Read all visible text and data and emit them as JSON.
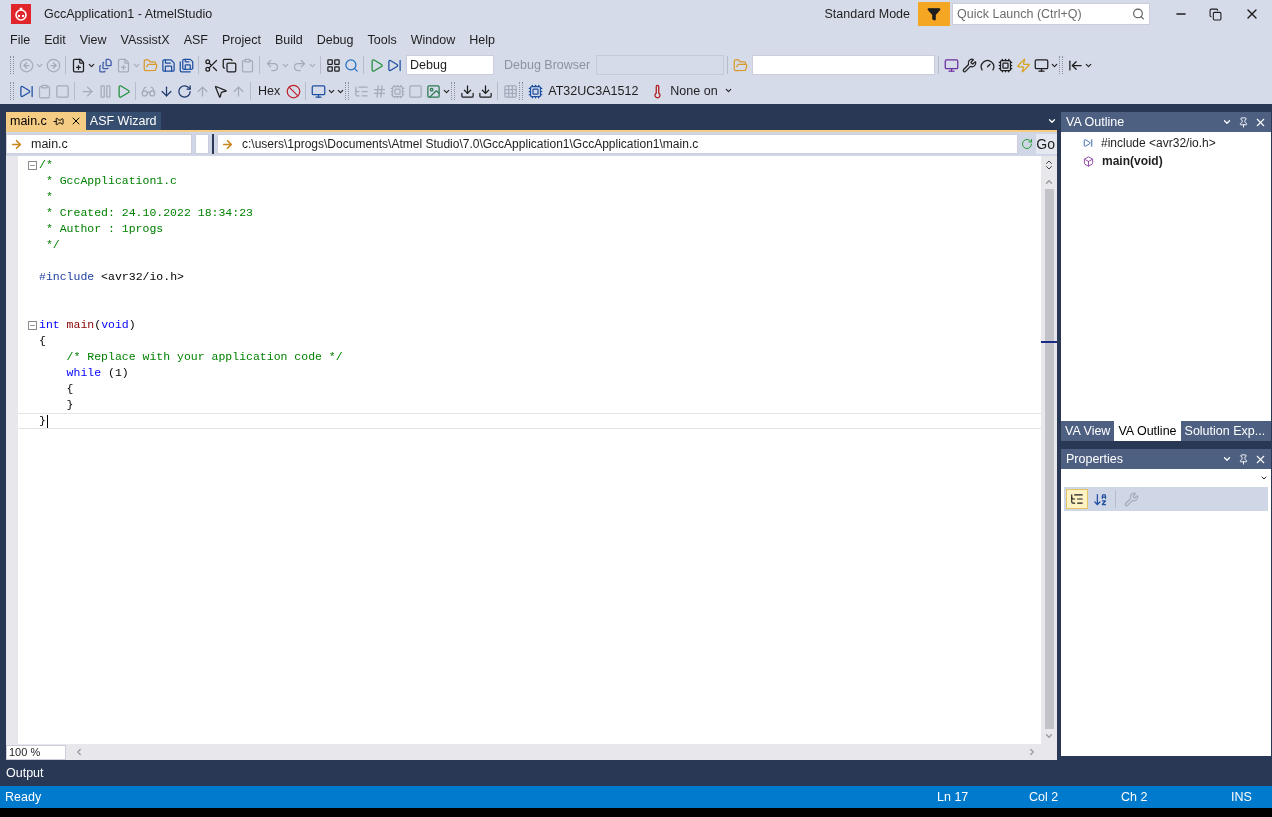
{
  "window": {
    "title": "GccApplication1 - AtmelStudio",
    "mode": "Standard Mode",
    "quick_launch": {
      "placeholder": "Quick Launch (Ctrl+Q)"
    }
  },
  "menu": [
    "File",
    "Edit",
    "View",
    "VAssistX",
    "ASF",
    "Project",
    "Build",
    "Debug",
    "Tools",
    "Window",
    "Help"
  ],
  "toolbar": {
    "configuration": "Debug",
    "debug_browser": "Debug Browser",
    "hex": "Hex",
    "device": "AT32UC3A1512",
    "tool": "None on"
  },
  "tabs": [
    {
      "label": "main.c",
      "selected": true
    },
    {
      "label": "ASF Wizard",
      "selected": false
    }
  ],
  "nav": {
    "file": "main.c",
    "path": "c:\\users\\1progs\\Documents\\Atmel Studio\\7.0\\GccApplication1\\GccApplication1\\main.c",
    "go": "Go"
  },
  "code": [
    {
      "kind": "code",
      "expanded": true,
      "tokens": [
        {
          "kind": "comment",
          "text": "/*"
        }
      ]
    },
    {
      "kind": "code",
      "tokens": [
        {
          "kind": "comment",
          "text": " * GccApplication1.c"
        }
      ]
    },
    {
      "kind": "code",
      "tokens": [
        {
          "kind": "comment",
          "text": " *"
        }
      ]
    },
    {
      "kind": "code",
      "tokens": [
        {
          "kind": "comment",
          "text": " * Created: 24.10.2022 18:34:23"
        }
      ]
    },
    {
      "kind": "code",
      "tokens": [
        {
          "kind": "comment",
          "text": " * Author : 1progs"
        }
      ]
    },
    {
      "kind": "code",
      "tokens": [
        {
          "kind": "comment",
          "text": " */"
        }
      ]
    },
    {
      "kind": "blank"
    },
    {
      "kind": "code",
      "tokens": [
        {
          "kind": "preprocessor",
          "text": "#include"
        },
        {
          "kind": "plain",
          "text": " <avr32/io.h>"
        }
      ]
    },
    {
      "kind": "blank"
    },
    {
      "kind": "blank"
    },
    {
      "kind": "code",
      "expanded": true,
      "tokens": [
        {
          "kind": "keyword",
          "text": "int"
        },
        {
          "kind": "function",
          "text": " main"
        },
        {
          "kind": "plain",
          "text": "("
        },
        {
          "kind": "keyword",
          "text": "void"
        },
        {
          "kind": "plain",
          "text": ")"
        }
      ]
    },
    {
      "kind": "code",
      "tokens": [
        {
          "kind": "plain",
          "text": "{"
        }
      ]
    },
    {
      "kind": "code",
      "tokens": [
        {
          "kind": "comment",
          "text": "    /* Replace with your application code */"
        }
      ]
    },
    {
      "kind": "code",
      "tokens": [
        {
          "kind": "keyword",
          "text": "    while"
        },
        {
          "kind": "plain",
          "text": " (1)"
        }
      ]
    },
    {
      "kind": "code",
      "tokens": [
        {
          "kind": "plain",
          "text": "    {"
        }
      ]
    },
    {
      "kind": "code",
      "tokens": [
        {
          "kind": "plain",
          "text": "    }"
        }
      ]
    },
    {
      "kind": "code",
      "current": true,
      "tokens": [
        {
          "kind": "plain",
          "text": "}"
        }
      ]
    }
  ],
  "zoom": "100 %",
  "outline": {
    "title": "VA Outline",
    "items": [
      {
        "kind": "include",
        "label": "#include <avr32/io.h>",
        "current": false
      },
      {
        "kind": "function",
        "label": "main(void)",
        "current": true
      }
    ]
  },
  "panel_tabs": [
    {
      "label": "VA View",
      "selected": false
    },
    {
      "label": "VA Outline",
      "selected": true
    },
    {
      "label": "Solution Exp...",
      "selected": false
    }
  ],
  "properties": {
    "title": "Properties"
  },
  "output": {
    "label": "Output"
  },
  "status": {
    "message": "Ready",
    "line": "Ln 17",
    "col": "Col 2",
    "ch": "Ch 2",
    "mode": "INS"
  }
}
